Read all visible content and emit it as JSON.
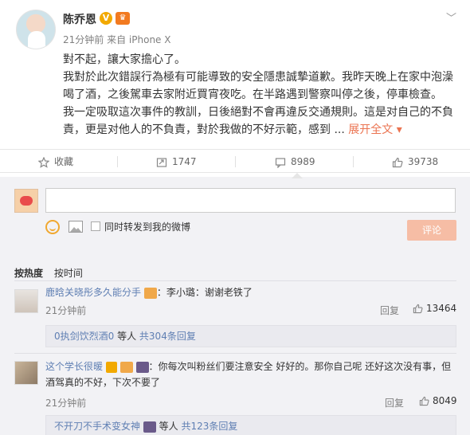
{
  "post": {
    "author": "陈乔恩",
    "verified_badge": "V",
    "member_badge": "♛",
    "time": "21分钟前",
    "source": "来自 iPhone X",
    "more_icon": "chevron-down-icon",
    "lines": [
      "對不起，讓大家擔心了。",
      "我對於此次錯誤行為極有可能導致的安全隱患誠摯道歉。我昨天晚上在家中泡澡",
      "喝了酒，之後駕車去家附近買宵夜吃。在半路遇到警察叫停之後，停車檢查。",
      "我一定吸取這次事件的教訓，日後絕對不會再違反交通規則。這是对自己的不負",
      "責，更是对他人的不負責，對於我做的不好示範，感到 ...",
      "展开全文"
    ]
  },
  "actions": {
    "favorite": "收藏",
    "repost_count": "1747",
    "comment_count": "8989",
    "like_count": "39738"
  },
  "composer": {
    "forward_label": "同时转发到我的微博",
    "submit_label": "评论"
  },
  "sort": {
    "hot": "按热度",
    "time": "按时间"
  },
  "comments": [
    {
      "user": "鹿晗关晓彤多久能分手",
      "text": "：李小璐：谢谢老铁了",
      "time": "21分钟前",
      "reply_label": "回复",
      "likes": "13464",
      "sub_user": "0执剑饮烈酒0",
      "sub_text": " 等人 ",
      "sub_count": "共304条回复"
    },
    {
      "user": "这个学长很暖",
      "text_line1": "：你每次叫粉丝们要注意安全 好好的。那你自己呢 还好这次没有事，但",
      "text_line2": "酒驾真的不好，下次不要了",
      "time": "21分钟前",
      "reply_label": "回复",
      "likes": "8049",
      "sub_user": "不开刀不手术变女神",
      "sub_text": " 等人 ",
      "sub_count": "共123条回复"
    }
  ]
}
